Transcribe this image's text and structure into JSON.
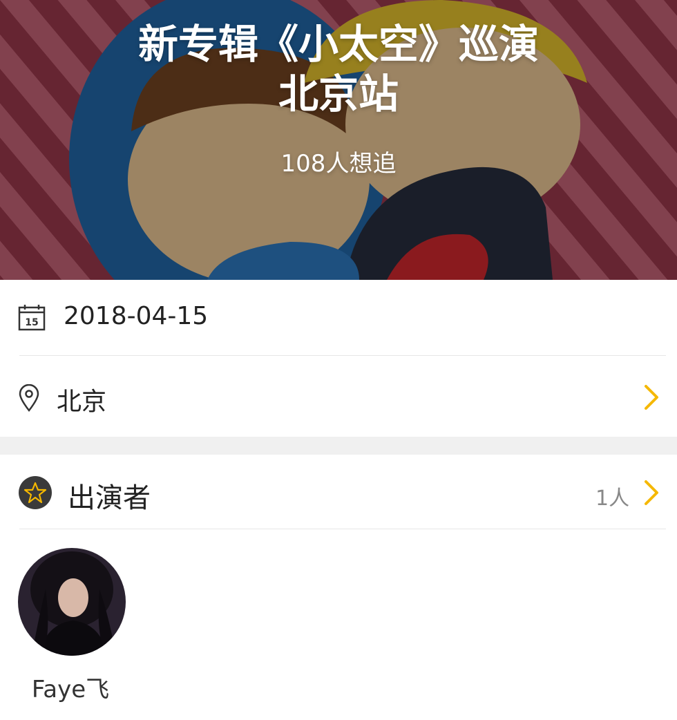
{
  "event": {
    "title_line1": "新专辑《小太空》巡演",
    "title_line2": "北京站",
    "interest": "108人想追"
  },
  "info": {
    "date": "2018-04-15",
    "calendar_day": "15",
    "city": "北京"
  },
  "performers": {
    "section_title": "出演者",
    "count": "1人",
    "items": [
      {
        "name": "Faye飞"
      }
    ]
  },
  "colors": {
    "accent_chevron": "#f5b800",
    "banner_stripe_a": "#8a2a3c",
    "banner_stripe_b": "#b85c6e"
  },
  "icons": [
    "calendar-icon",
    "location-pin-icon",
    "star-icon",
    "chevron-right-icon"
  ]
}
